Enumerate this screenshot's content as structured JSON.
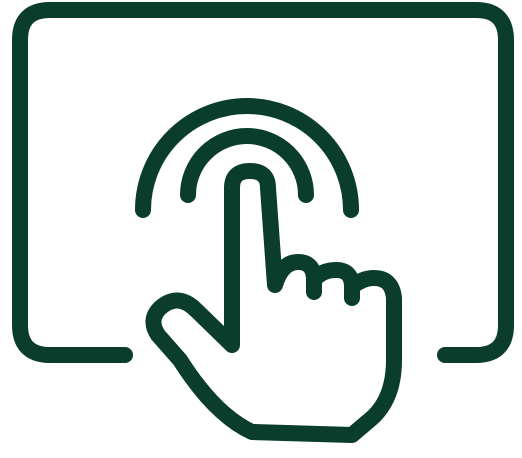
{
  "icon": {
    "name": "touch-screen-tap-icon",
    "color": "#0a3d2b",
    "background": "#ffffff"
  }
}
